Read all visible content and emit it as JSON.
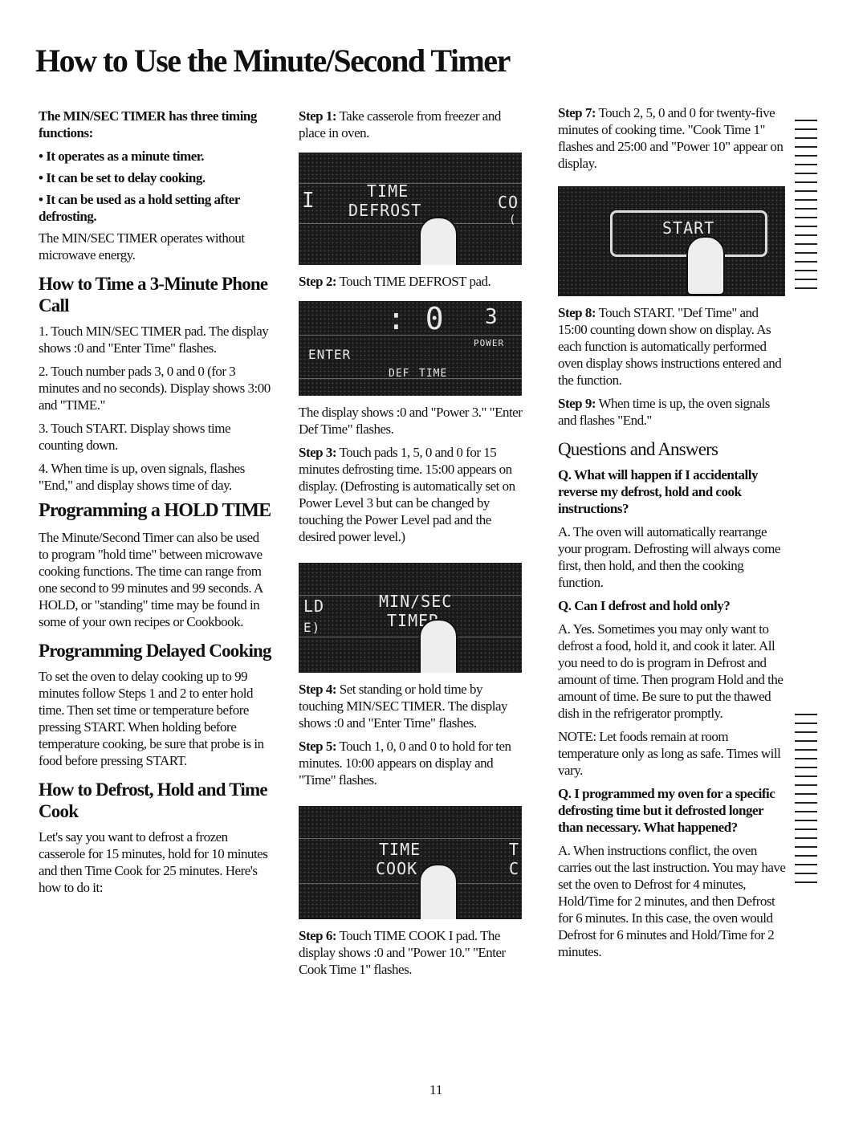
{
  "title": "How to Use the Minute/Second Timer",
  "col1": {
    "intro_bold": "The MIN/SEC TIMER has three timing functions:",
    "bullets": [
      "It operates as a minute timer.",
      "It can be set to delay cooking.",
      "It can be used as a hold setting after defrosting."
    ],
    "intro_note": "The MIN/SEC TIMER operates without microwave energy.",
    "phone_heading": "How to Time a 3-Minute Phone Call",
    "phone_steps": [
      "1. Touch MIN/SEC TIMER pad. The display shows :0 and \"Enter Time\" flashes.",
      "2. Touch number pads 3, 0 and 0 (for 3 minutes and no seconds). Display shows 3:00 and \"TIME.\"",
      "3. Touch START. Display shows time counting down.",
      "4. When time is up, oven signals, flashes \"End,\" and display shows time of day."
    ],
    "hold_heading": "Programming a HOLD TIME",
    "hold_text": "The Minute/Second Timer can also be used to program \"hold time\" between microwave cooking functions. The time can range from one second to 99 minutes and 99 seconds. A HOLD, or \"standing\" time may be found in some of your own recipes or Cookbook.",
    "delayed_heading": "Programming Delayed Cooking",
    "delayed_text": "To set the oven to delay cooking up to 99 minutes follow Steps 1 and 2 to enter hold time. Then set time or temperature before pressing START. When holding before temperature cooking, be sure that probe is in food before pressing START.",
    "defrost_heading": "How to Defrost, Hold and Time Cook",
    "defrost_text": "Let's say you want to defrost a frozen casserole for 15 minutes, hold for 10 minutes and then Time Cook for 25 minutes. Here's how to do it:"
  },
  "col2": {
    "step1_label": "Step 1:",
    "step1": "Take casserole from freezer and place in oven.",
    "panel1": {
      "left": "I",
      "top": "TIME",
      "bottom": "DEFROST",
      "right_top": "CO",
      "right_bottom": "("
    },
    "step2_label": "Step 2:",
    "step2": "Touch TIME DEFROST pad.",
    "panel2": {
      "digits": ": 0",
      "power": "3",
      "power_label": "POWER",
      "enter": "ENTER",
      "def": "DEF",
      "time": "TIME"
    },
    "after2": "The display shows :0 and \"Power 3.\" \"Enter Def Time\" flashes.",
    "step3_label": "Step 3:",
    "step3": "Touch pads 1, 5, 0 and 0 for 15 minutes defrosting time. 15:00 appears on display. (Defrosting is automatically set on Power Level 3 but can be changed by touching the Power Level pad and the desired power level.)",
    "panel3": {
      "left_top": "LD",
      "left_bottom": "E)",
      "top": "MIN/SEC",
      "bottom": "TIMER"
    },
    "step4_label": "Step 4:",
    "step4": "Set standing or hold time by touching MIN/SEC TIMER. The display shows :0 and \"Enter Time\" flashes.",
    "step5_label": "Step 5:",
    "step5": "Touch 1, 0, 0 and 0 to hold for ten minutes. 10:00 appears on display and \"Time\" flashes.",
    "panel4": {
      "top": "TIME",
      "bottom": "COOK",
      "right_top": "T",
      "right_bottom": "C"
    },
    "step6_label": "Step 6:",
    "step6": "Touch TIME COOK I pad. The display shows :0 and \"Power 10.\" \"Enter Cook Time 1\" flashes."
  },
  "col3": {
    "step7_label": "Step 7:",
    "step7": "Touch 2, 5, 0 and 0 for twenty-five minutes of cooking time. \"Cook Time 1\" flashes and 25:00 and \"Power 10\" appear on display.",
    "panel5": {
      "label": "START"
    },
    "step8_label": "Step 8:",
    "step8": "Touch START. \"Def Time\" and 15:00 counting down show on display. As each function is automatically performed oven display shows instructions entered and the function.",
    "step9_label": "Step 9:",
    "step9": "When time is up, the oven signals and flashes \"End.\"",
    "qa_heading": "Questions and Answers",
    "qa": [
      {
        "q": "Q. What will happen if I accidentally reverse my defrost, hold and cook instructions?",
        "a": [
          "A. The oven will automatically rearrange your program. Defrosting will always come first, then hold, and then the cooking function."
        ]
      },
      {
        "q": "Q. Can I defrost and hold only?",
        "a": [
          "A. Yes. Sometimes you may only want to defrost a food, hold it, and cook it later. All you need to do is program in Defrost and amount of time. Then program Hold and the amount of time. Be sure to put the thawed dish in the refrigerator promptly.",
          "NOTE: Let foods remain at room temperature only as long as safe. Times will vary."
        ]
      },
      {
        "q": "Q. I programmed my oven for a specific defrosting time but it defrosted longer than necessary. What happened?",
        "a": [
          "A. When instructions conflict, the oven carries out the last instruction. You may have set the oven to Defrost for 4 minutes, Hold/Time for 2 minutes, and then Defrost for 6 minutes. In this case, the oven would Defrost for 6 minutes and Hold/Time for 2 minutes."
        ]
      }
    ]
  },
  "page_number": "11"
}
